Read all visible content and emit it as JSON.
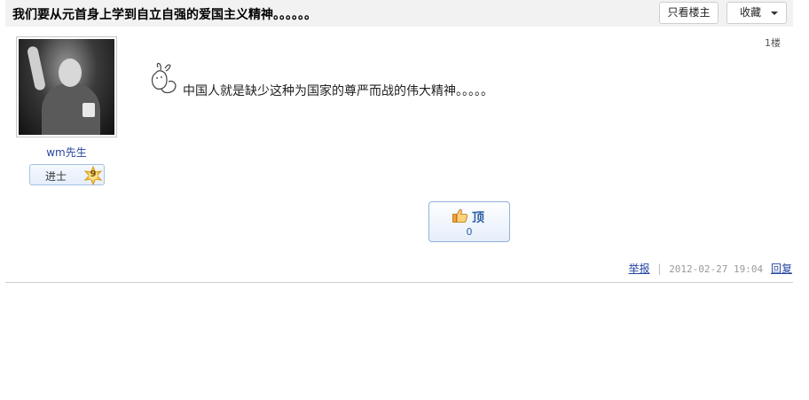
{
  "thread": {
    "title": "我们要从元首身上学到自立自强的爱国主义精神。。。。。。"
  },
  "toolbar": {
    "only_op_label": "只看楼主",
    "favorite_label": "收藏"
  },
  "post": {
    "author": {
      "name": "wm先生",
      "rank_title": "进士",
      "rank_level": "9"
    },
    "floor": "1楼",
    "content": "中国人就是缺少这种为国家的尊严而战的伟大精神。。。。。",
    "like": {
      "label": "顶",
      "count": "0"
    },
    "footer": {
      "report_label": "举报",
      "timestamp": "2012-02-27 19:04",
      "reply_label": "回复"
    }
  }
}
